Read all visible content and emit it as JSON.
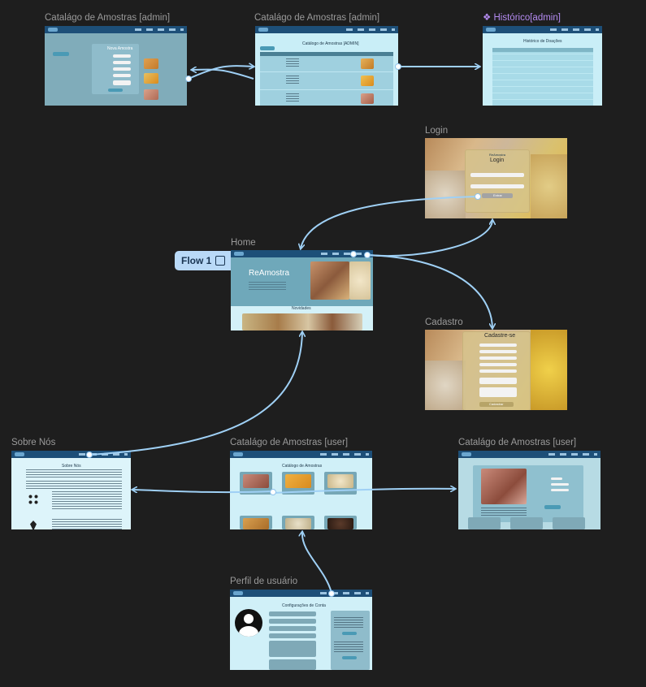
{
  "canvas": {
    "labels": {
      "catalog_admin_1": "Catalágo de Amostras [admin]",
      "catalog_admin_2": "Catalágo de Amostras [admin]",
      "history_admin": "❖ Histórico[admin]",
      "login": "Login",
      "home": "Home",
      "cadastro": "Cadastro",
      "sobre": "Sobre Nós",
      "catalog_user_1": "Catalágo de Amostras [user]",
      "catalog_user_2": "Catalágo de Amostras [user]",
      "perfil": "Perfil de usuário"
    },
    "flow_chip": {
      "label": "Flow 1",
      "icon": "flow-start-icon"
    }
  },
  "frames": {
    "catalog_admin_1": {
      "modal_title": "Nova Amostra"
    },
    "catalog_admin_2": {
      "title": "Catálogo de Amostras [ADMIN]"
    },
    "history": {
      "title": "Histórico de Doações"
    },
    "login": {
      "brand": "ReAmostra",
      "title": "Login",
      "button": "Entrar"
    },
    "home": {
      "hero_title": "ReAmostra",
      "section_title": "Novidades"
    },
    "cadastro": {
      "title": "Cadastre-se",
      "button": "Cadastrar"
    },
    "sobre": {
      "title": "Sobre Nós"
    },
    "catalog_user_1": {
      "title": "Catálogo de Amostras"
    },
    "perfil": {
      "title": "Configurações de Conta"
    }
  },
  "colors": {
    "background": "#1e1e1e",
    "connector": "#9fd0f5",
    "nav": "#1d4f78",
    "frame_bg": "#c9eef7"
  }
}
